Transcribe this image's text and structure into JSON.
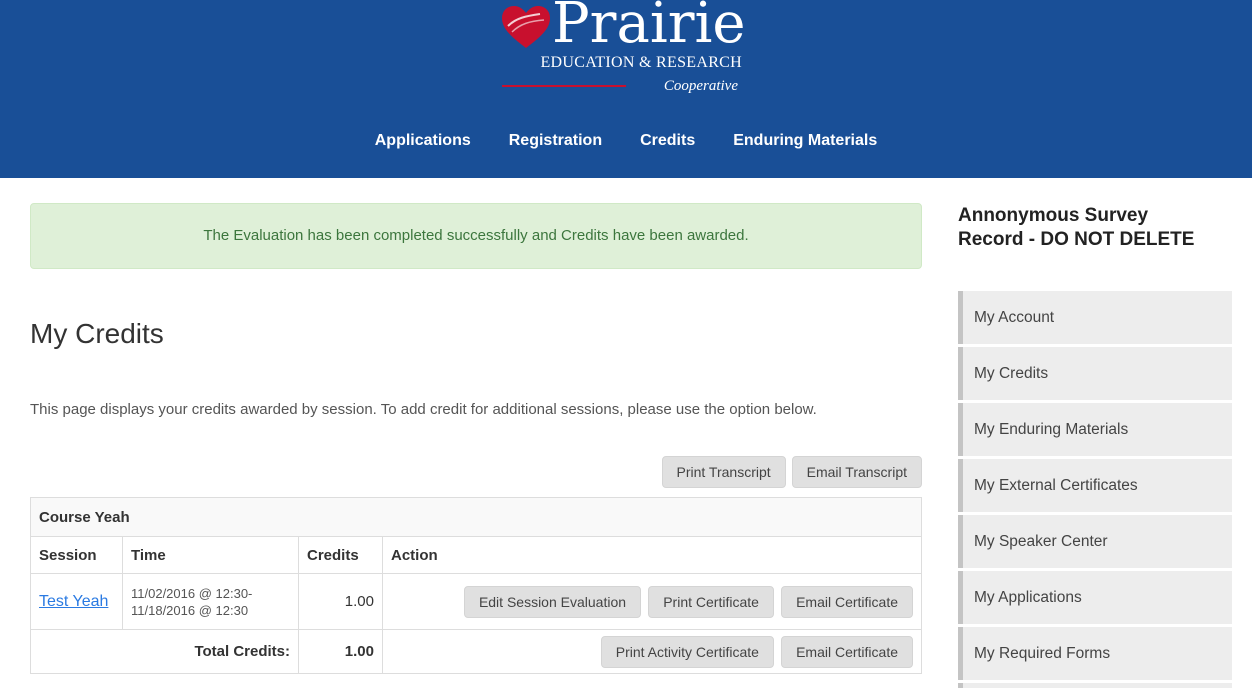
{
  "header": {
    "logo_title": "Prairie",
    "logo_subtitle": "EDUCATION & RESEARCH",
    "logo_tagline": "Cooperative",
    "brand_color": "#194f97",
    "accent_color": "#c8102e",
    "nav": [
      {
        "label": "Applications"
      },
      {
        "label": "Registration"
      },
      {
        "label": "Credits"
      },
      {
        "label": "Enduring Materials"
      }
    ]
  },
  "alert": {
    "message": "The Evaluation has been completed successfully and Credits have been awarded."
  },
  "main": {
    "title": "My Credits",
    "description": "This page displays your credits awarded by session. To add credit for additional sessions, please use the option below.",
    "print_transcript_label": "Print Transcript",
    "email_transcript_label": "Email Transcript"
  },
  "table": {
    "course_name": "Course Yeah",
    "columns": [
      "Session",
      "Time",
      "Credits",
      "Action"
    ],
    "rows": [
      {
        "session": "Test Yeah",
        "time_start": "11/02/2016 @ 12:30-",
        "time_end": "11/18/2016 @ 12:30",
        "credits": "1.00",
        "actions": [
          "Edit Session Evaluation",
          "Print Certificate",
          "Email Certificate"
        ]
      }
    ],
    "total_label": "Total Credits:",
    "total_value": "1.00",
    "total_actions": [
      "Print Activity Certificate",
      "Email Certificate"
    ]
  },
  "sidebar": {
    "title": "Annonymous Survey Record - DO NOT DELETE",
    "items": [
      {
        "label": "My Account"
      },
      {
        "label": "My Credits"
      },
      {
        "label": "My Enduring Materials"
      },
      {
        "label": "My External Certificates"
      },
      {
        "label": "My Speaker Center"
      },
      {
        "label": "My Applications"
      },
      {
        "label": "My Required Forms"
      }
    ]
  }
}
